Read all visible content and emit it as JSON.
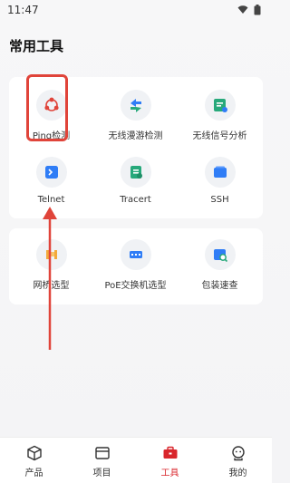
{
  "status": {
    "time": "11:47"
  },
  "header": {
    "title": "常用工具"
  },
  "tools_group_1": [
    {
      "label": "Ping检测",
      "icon": "ping-icon"
    },
    {
      "label": "无线漫游检测",
      "icon": "roaming-icon"
    },
    {
      "label": "无线信号分析",
      "icon": "signal-analysis-icon"
    },
    {
      "label": "Telnet",
      "icon": "telnet-icon"
    },
    {
      "label": "Tracert",
      "icon": "tracert-icon"
    },
    {
      "label": "SSH",
      "icon": "ssh-icon"
    }
  ],
  "tools_group_2": [
    {
      "label": "网桥选型",
      "icon": "bridge-icon"
    },
    {
      "label": "PoE交换机选型",
      "icon": "poe-switch-icon"
    },
    {
      "label": "包装速查",
      "icon": "package-lookup-icon"
    }
  ],
  "nav": [
    {
      "label": "产品",
      "icon": "product-icon",
      "active": false
    },
    {
      "label": "项目",
      "icon": "project-icon",
      "active": false
    },
    {
      "label": "工具",
      "icon": "toolbox-icon",
      "active": true
    },
    {
      "label": "我的",
      "icon": "profile-icon",
      "active": false
    }
  ],
  "colors": {
    "accent": "#d9262c",
    "highlight": "#e0443a",
    "icon_blue": "#2f7df6",
    "icon_green": "#27a97b",
    "icon_orange": "#f3a93b"
  }
}
